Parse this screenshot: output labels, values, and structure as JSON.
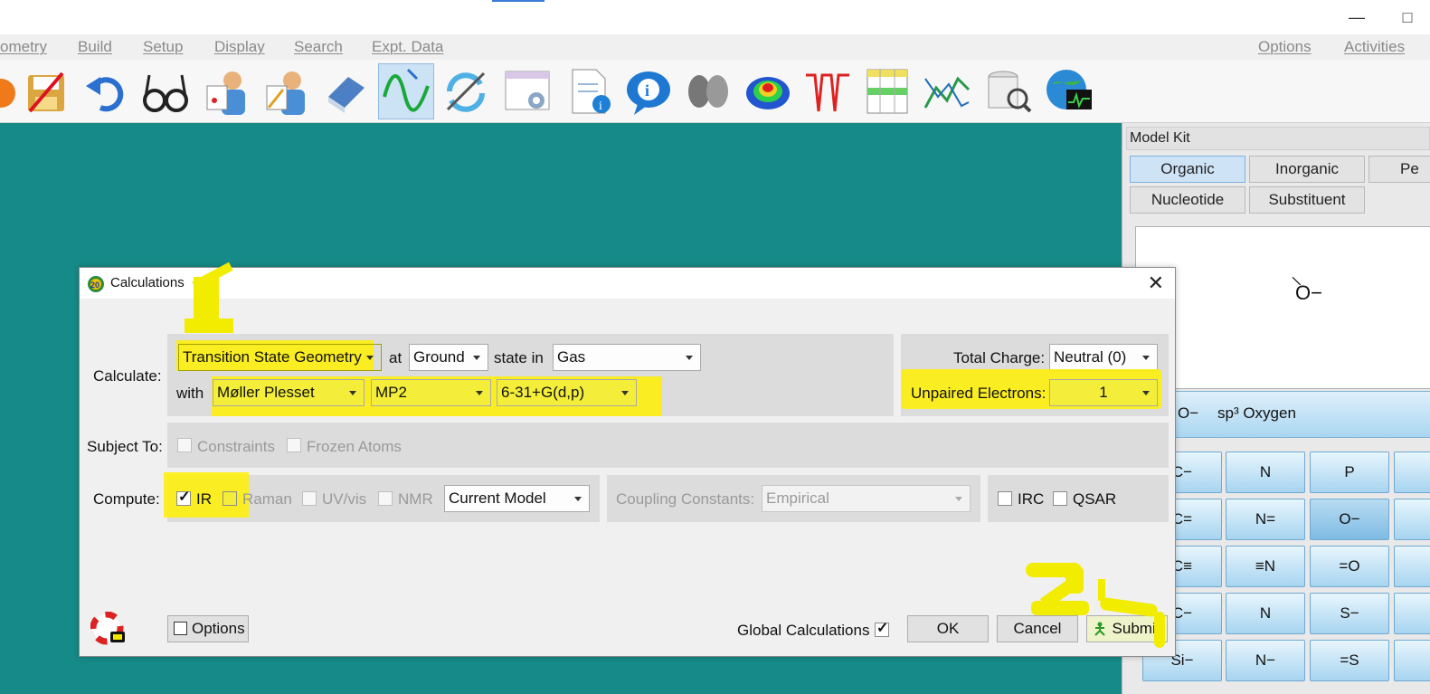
{
  "menubar": {
    "items": [
      "ometry",
      "Build",
      "Setup",
      "Display",
      "Search",
      "Expt. Data",
      "Options",
      "Activities"
    ]
  },
  "toolbar": {
    "tools": [
      "new-icon",
      "save-icon",
      "undo-icon",
      "view-glasses-icon",
      "build-molecule-icon",
      "edit-molecule-icon",
      "eraser-icon",
      "minimize-icon",
      "replace-icon",
      "calculations-setup-icon",
      "document-info-icon",
      "info-icon",
      "orbital-icon",
      "electrostatic-map-icon",
      "spectra-icon",
      "spreadsheet-icon",
      "plot-icon",
      "database-search-icon",
      "web-search-icon"
    ]
  },
  "modelkit": {
    "title": "Model Kit",
    "tabs": [
      "Organic",
      "Inorganic",
      "Pe",
      "Nucleotide",
      "Substituent"
    ],
    "preview_label": "O−",
    "selected_fragment": "sp³ Oxygen",
    "selected_fragment_symbol": "O−",
    "fragments": [
      "C−",
      "N",
      "P",
      "C=",
      "N=",
      "O−",
      "C≡",
      "≡N",
      "=O",
      "C−",
      "N",
      "S−",
      "Si−",
      "N−",
      "=S"
    ]
  },
  "dialog": {
    "title": "Calculations",
    "calculate_label": "Calculate:",
    "calc_type": "Transition State Geometry",
    "at_label": "at",
    "state": "Ground",
    "state_in_label": "state in",
    "medium": "Gas",
    "with_label": "with",
    "method": "Møller Plesset",
    "level": "MP2",
    "basis": "6-31+G(d,p)",
    "total_charge_label": "Total Charge:",
    "total_charge": "Neutral (0)",
    "unpaired_label": "Unpaired Electrons:",
    "unpaired": "1",
    "subject_to_label": "Subject To:",
    "constraints_label": "Constraints",
    "frozen_label": "Frozen Atoms",
    "compute_label": "Compute:",
    "ir_label": "IR",
    "raman_label": "Raman",
    "uvvis_label": "UV/vis",
    "nmr_label": "NMR",
    "model_scope": "Current Model",
    "coupling_label": "Coupling Constants:",
    "coupling_value": "Empirical",
    "irc_label": "IRC",
    "qsar_label": "QSAR",
    "options_label": "Options",
    "global_label": "Global Calculations",
    "ok_label": "OK",
    "cancel_label": "Cancel",
    "submit_label": "Submit"
  },
  "annotations": {
    "step1": "1",
    "step2": "2"
  },
  "colors": {
    "desktop": "#168a88",
    "highlight": "#f1ec00",
    "selected_tab": "#cfe3f7"
  }
}
